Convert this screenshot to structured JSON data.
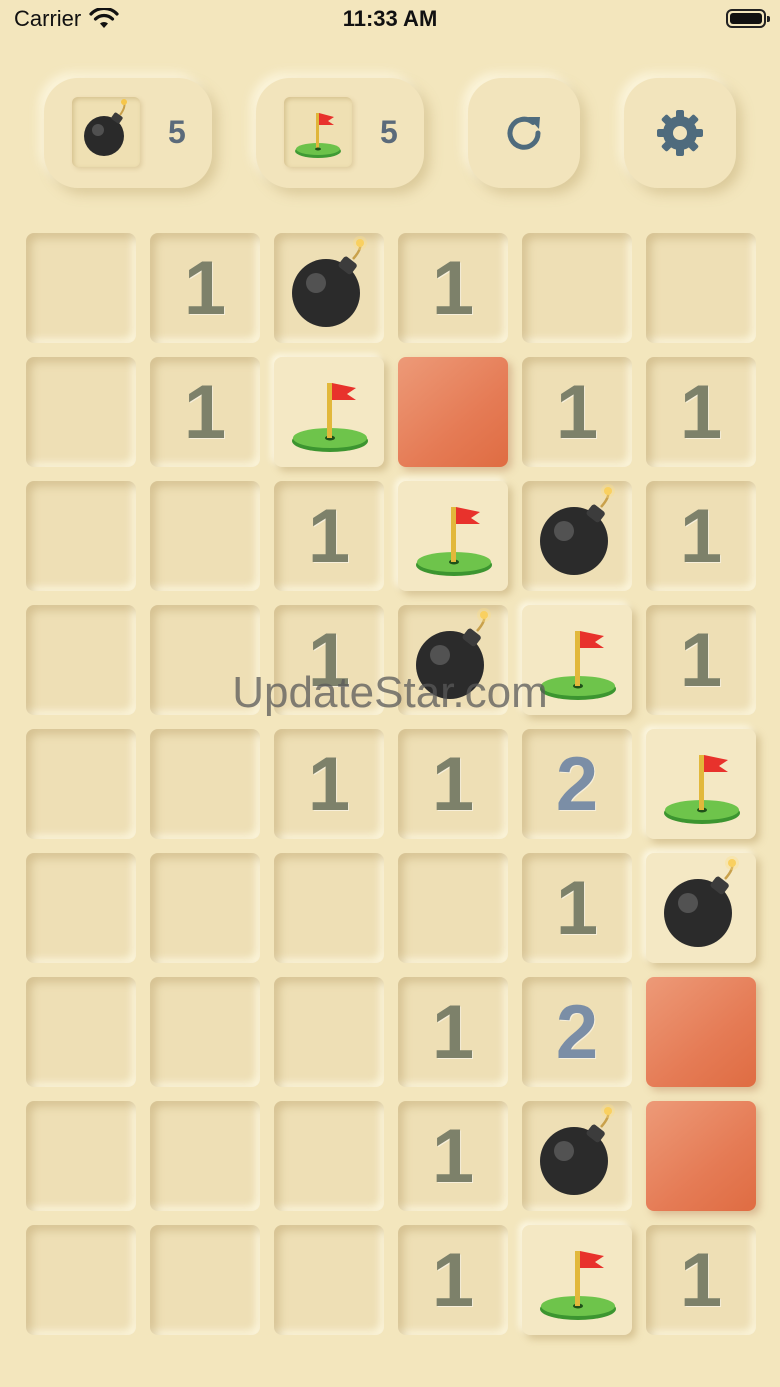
{
  "status_bar": {
    "carrier": "Carrier",
    "time": "11:33 AM"
  },
  "header": {
    "mine_counter": {
      "icon": "bomb-icon",
      "value": "5"
    },
    "flag_counter": {
      "icon": "flag-icon",
      "value": "5"
    },
    "restart_button": {
      "icon": "refresh-icon"
    },
    "settings_button": {
      "icon": "gear-icon"
    }
  },
  "board": {
    "rows": 9,
    "cols": 6,
    "cells": [
      [
        "empty",
        "1",
        "bomb",
        "1",
        "empty",
        "empty"
      ],
      [
        "empty",
        "1",
        "flag",
        "red",
        "1",
        "1"
      ],
      [
        "empty",
        "empty",
        "1",
        "flag",
        "bomb",
        "1"
      ],
      [
        "empty",
        "empty",
        "1",
        "bomb",
        "flag",
        "1"
      ],
      [
        "empty",
        "empty",
        "1",
        "1",
        "2",
        "flag"
      ],
      [
        "empty",
        "empty",
        "empty",
        "empty",
        "1",
        "bomb-raised"
      ],
      [
        "empty",
        "empty",
        "empty",
        "1",
        "2",
        "red"
      ],
      [
        "empty",
        "empty",
        "empty",
        "1",
        "bomb",
        "red"
      ],
      [
        "empty",
        "empty",
        "empty",
        "1",
        "flag",
        "1"
      ]
    ]
  },
  "watermark": "UpdateStar.com",
  "colors": {
    "background": "#f3e6bd",
    "number_one": "#7d816a",
    "number_two": "#7b8ea6",
    "accent_icon": "#4f6b7d",
    "highlight_red": "#e57b55"
  }
}
